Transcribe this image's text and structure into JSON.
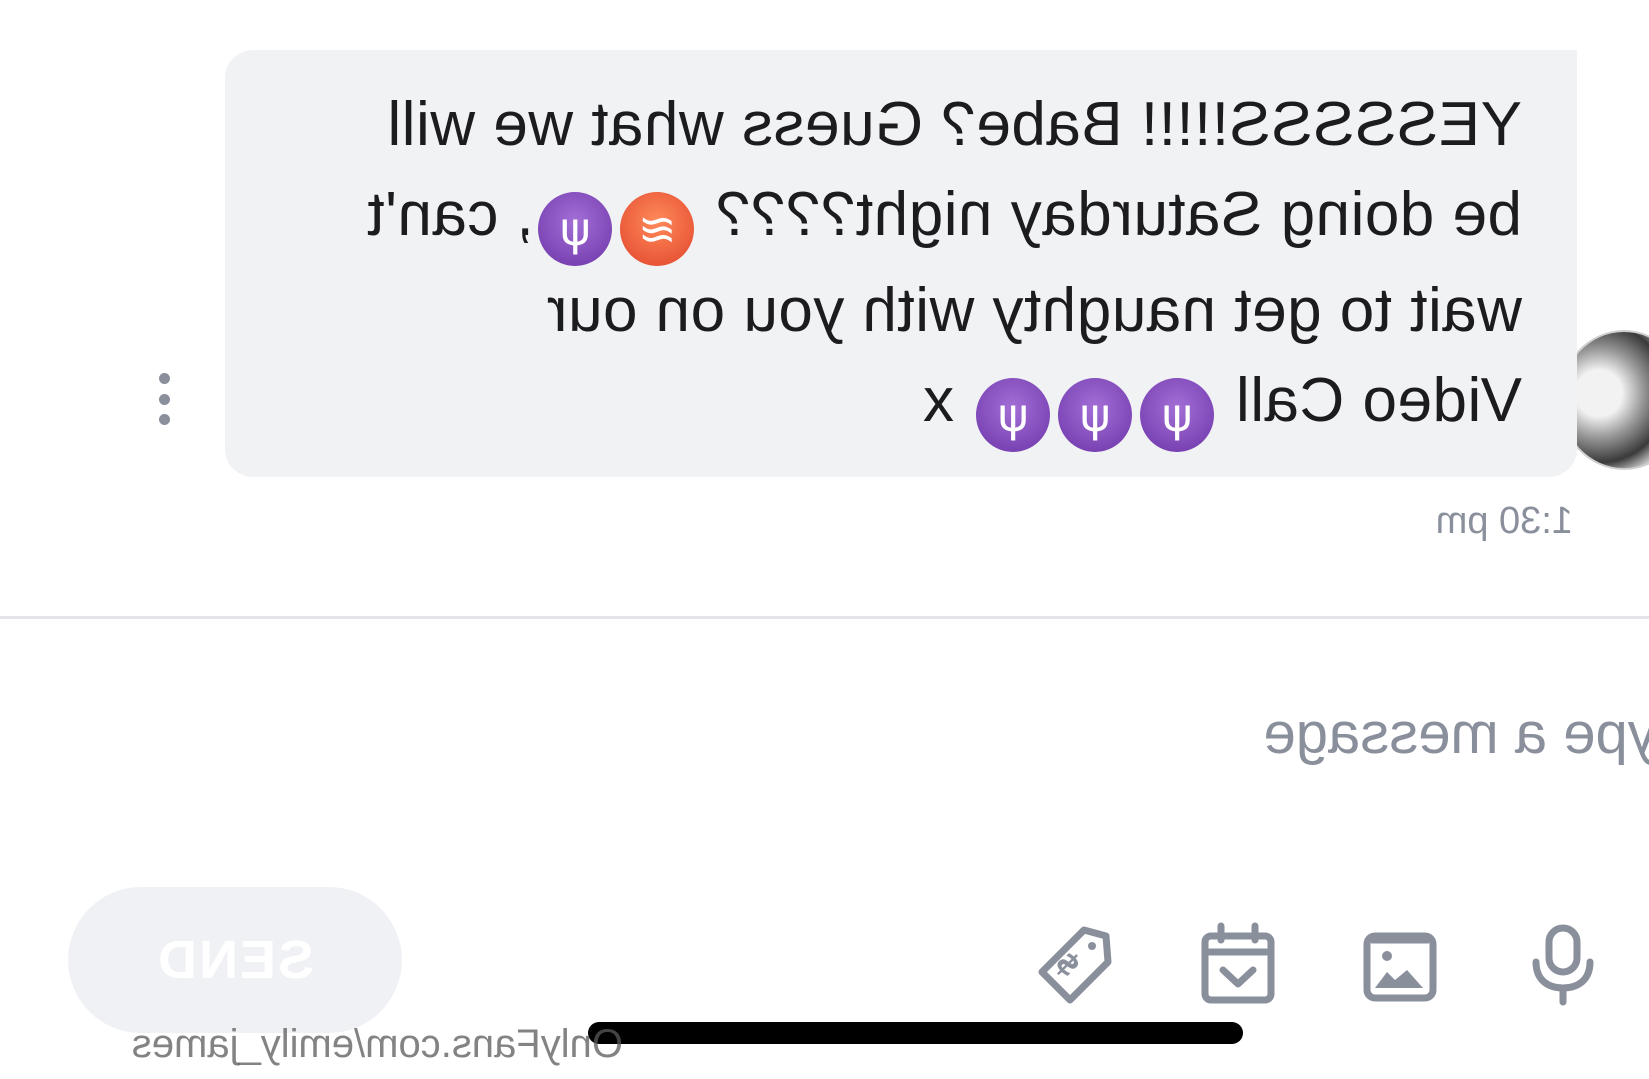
{
  "message": {
    "lines": [
      {
        "text": "YESSSSS!!!!! Babe? Guess what we will",
        "emojis": []
      },
      {
        "text": "be doing Saturday night???? ",
        "emojis": [
          "hot-face",
          "devil"
        ],
        "after": ", can't"
      },
      {
        "text": "wait to get naughty with you on our",
        "emojis": []
      },
      {
        "text": "Video Call ",
        "emojis": [
          "devil",
          "devil",
          "devil"
        ],
        "after": " x"
      }
    ],
    "time": "1:30 pm",
    "emoji_glyphs": {
      "devil": "😈",
      "hot-face": "🥵"
    }
  },
  "composer": {
    "placeholder": "Type a message",
    "send_label": "SEND"
  },
  "toolbar": {
    "icons": [
      "microphone-icon",
      "media-icon",
      "schedule-icon",
      "price-tag-icon"
    ]
  },
  "watermark": "OnlyFans.com/emily_james",
  "colors": {
    "bubble": "#f1f2f4",
    "muted": "#8a8f9c",
    "send_disabled": "#f0f1f4"
  }
}
